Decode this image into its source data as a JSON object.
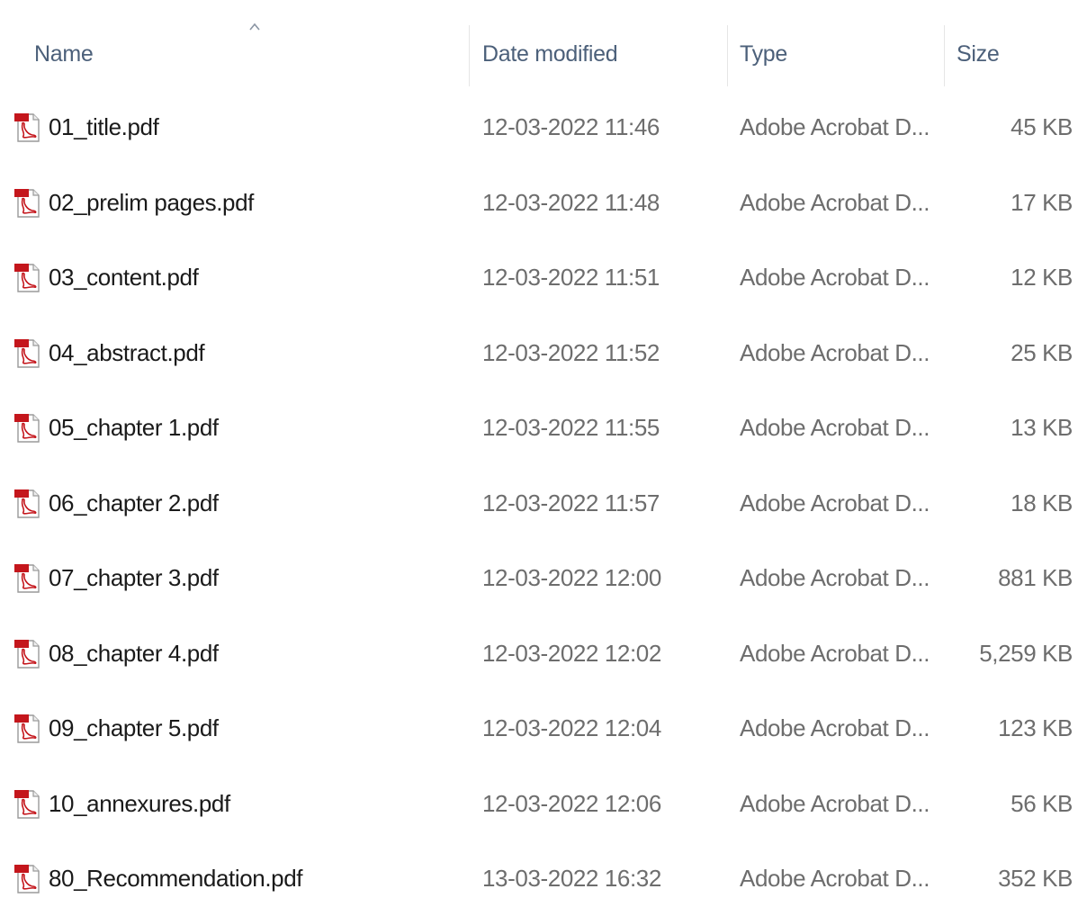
{
  "columns": {
    "name": "Name",
    "date": "Date modified",
    "type": "Type",
    "size": "Size"
  },
  "sort": {
    "column": "name",
    "direction": "ascending",
    "icon": "chevron-up-icon"
  },
  "files": [
    {
      "name": "01_title.pdf",
      "date": "12-03-2022 11:46",
      "type": "Adobe Acrobat D...",
      "size": "45 KB",
      "icon": "pdf-file-icon"
    },
    {
      "name": "02_prelim pages.pdf",
      "date": "12-03-2022 11:48",
      "type": "Adobe Acrobat D...",
      "size": "17 KB",
      "icon": "pdf-file-icon"
    },
    {
      "name": "03_content.pdf",
      "date": "12-03-2022 11:51",
      "type": "Adobe Acrobat D...",
      "size": "12 KB",
      "icon": "pdf-file-icon"
    },
    {
      "name": "04_abstract.pdf",
      "date": "12-03-2022 11:52",
      "type": "Adobe Acrobat D...",
      "size": "25 KB",
      "icon": "pdf-file-icon"
    },
    {
      "name": "05_chapter 1.pdf",
      "date": "12-03-2022 11:55",
      "type": "Adobe Acrobat D...",
      "size": "13 KB",
      "icon": "pdf-file-icon"
    },
    {
      "name": "06_chapter 2.pdf",
      "date": "12-03-2022 11:57",
      "type": "Adobe Acrobat D...",
      "size": "18 KB",
      "icon": "pdf-file-icon"
    },
    {
      "name": "07_chapter 3.pdf",
      "date": "12-03-2022 12:00",
      "type": "Adobe Acrobat D...",
      "size": "881 KB",
      "icon": "pdf-file-icon"
    },
    {
      "name": "08_chapter 4.pdf",
      "date": "12-03-2022 12:02",
      "type": "Adobe Acrobat D...",
      "size": "5,259 KB",
      "icon": "pdf-file-icon"
    },
    {
      "name": "09_chapter 5.pdf",
      "date": "12-03-2022 12:04",
      "type": "Adobe Acrobat D...",
      "size": "123 KB",
      "icon": "pdf-file-icon"
    },
    {
      "name": "10_annexures.pdf",
      "date": "12-03-2022 12:06",
      "type": "Adobe Acrobat D...",
      "size": "56 KB",
      "icon": "pdf-file-icon"
    },
    {
      "name": "80_Recommendation.pdf",
      "date": "13-03-2022 16:32",
      "type": "Adobe Acrobat D...",
      "size": "352 KB",
      "icon": "pdf-file-icon"
    }
  ],
  "colors": {
    "header_text": "#4c607a",
    "name_text": "#1a1a1a",
    "detail_text": "#6d6d6d",
    "pdf_red": "#c4161c"
  }
}
